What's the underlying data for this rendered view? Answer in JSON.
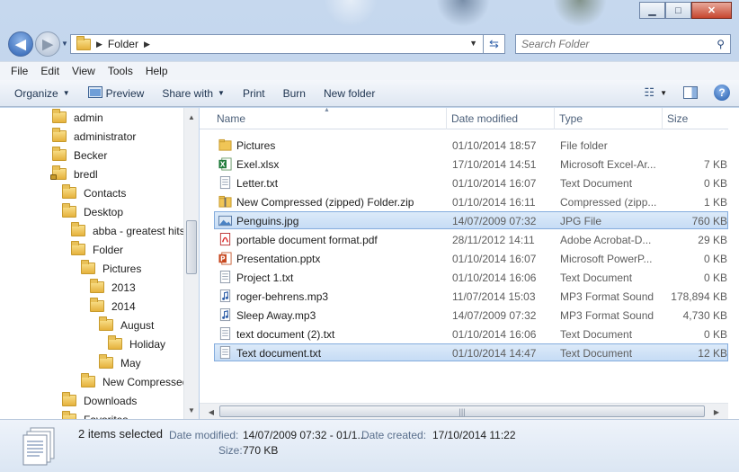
{
  "window": {
    "caption_buttons": {
      "minimize": "▁",
      "maximize": "□",
      "close": "✕"
    }
  },
  "address_bar": {
    "crumbs": [
      "Folder"
    ],
    "separator": "▶",
    "search_placeholder": "Search Folder"
  },
  "menu": [
    "File",
    "Edit",
    "View",
    "Tools",
    "Help"
  ],
  "toolbar": {
    "organize": "Organize",
    "preview": "Preview",
    "share_with": "Share with",
    "print": "Print",
    "burn": "Burn",
    "new_folder": "New folder"
  },
  "nav_tree": [
    {
      "label": "admin",
      "depth": 0
    },
    {
      "label": "administrator",
      "depth": 0
    },
    {
      "label": "Becker",
      "depth": 0
    },
    {
      "label": "bredl",
      "depth": 0,
      "locked": true
    },
    {
      "label": "Contacts",
      "depth": 1
    },
    {
      "label": "Desktop",
      "depth": 1
    },
    {
      "label": "abba - greatest hits",
      "depth": 2
    },
    {
      "label": "Folder",
      "depth": 2
    },
    {
      "label": "Pictures",
      "depth": 3
    },
    {
      "label": "2013",
      "depth": 4
    },
    {
      "label": "2014",
      "depth": 4
    },
    {
      "label": "August",
      "depth": 5
    },
    {
      "label": "Holiday",
      "depth": 6
    },
    {
      "label": "May",
      "depth": 5
    },
    {
      "label": "New Compressed",
      "depth": 3
    },
    {
      "label": "Downloads",
      "depth": 1
    },
    {
      "label": "Favorites",
      "depth": 1
    }
  ],
  "columns": {
    "name": "Name",
    "date": "Date modified",
    "type": "Type",
    "size": "Size"
  },
  "files": [
    {
      "name": "Pictures",
      "date": "01/10/2014 18:57",
      "type": "File folder",
      "size": "",
      "icon": "folder-icon",
      "selected": false
    },
    {
      "name": "Exel.xlsx",
      "date": "17/10/2014 14:51",
      "type": "Microsoft Excel-Ar...",
      "size": "7 KB",
      "icon": "excel-icon",
      "selected": false
    },
    {
      "name": "Letter.txt",
      "date": "01/10/2014 16:07",
      "type": "Text Document",
      "size": "0 KB",
      "icon": "text-file-icon",
      "selected": false
    },
    {
      "name": "New Compressed (zipped) Folder.zip",
      "date": "01/10/2014 16:11",
      "type": "Compressed (zipp...",
      "size": "1 KB",
      "icon": "zip-folder-icon",
      "selected": false
    },
    {
      "name": "Penguins.jpg",
      "date": "14/07/2009 07:32",
      "type": "JPG File",
      "size": "760 KB",
      "icon": "image-file-icon",
      "selected": true
    },
    {
      "name": "portable document format.pdf",
      "date": "28/11/2012 14:11",
      "type": "Adobe Acrobat-D...",
      "size": "29 KB",
      "icon": "pdf-icon",
      "selected": false
    },
    {
      "name": "Presentation.pptx",
      "date": "01/10/2014 16:07",
      "type": "Microsoft PowerP...",
      "size": "0 KB",
      "icon": "powerpoint-icon",
      "selected": false
    },
    {
      "name": "Project 1.txt",
      "date": "01/10/2014 16:06",
      "type": "Text Document",
      "size": "0 KB",
      "icon": "text-file-icon",
      "selected": false
    },
    {
      "name": "roger-behrens.mp3",
      "date": "11/07/2014 15:03",
      "type": "MP3 Format Sound",
      "size": "178,894 KB",
      "icon": "audio-file-icon",
      "selected": false
    },
    {
      "name": "Sleep Away.mp3",
      "date": "14/07/2009 07:32",
      "type": "MP3 Format Sound",
      "size": "4,730 KB",
      "icon": "audio-file-icon",
      "selected": false
    },
    {
      "name": "text document (2).txt",
      "date": "01/10/2014 16:06",
      "type": "Text Document",
      "size": "0 KB",
      "icon": "text-file-icon",
      "selected": false
    },
    {
      "name": "Text document.txt",
      "date": "01/10/2014 14:47",
      "type": "Text Document",
      "size": "12 KB",
      "icon": "text-file-icon",
      "selected": true
    }
  ],
  "details": {
    "count": "2 items selected",
    "date_modified_label": "Date modified:",
    "date_modified_value": "14/07/2009 07:32 - 01/1...",
    "date_created_label": "Date created:",
    "date_created_value": "17/10/2014 11:22",
    "size_label": "Size:",
    "size_value": "770 KB"
  },
  "colors": {
    "selection_fill": "#cfe3f8",
    "selection_border": "#84acdd",
    "chrome": "#c6d8ee"
  }
}
